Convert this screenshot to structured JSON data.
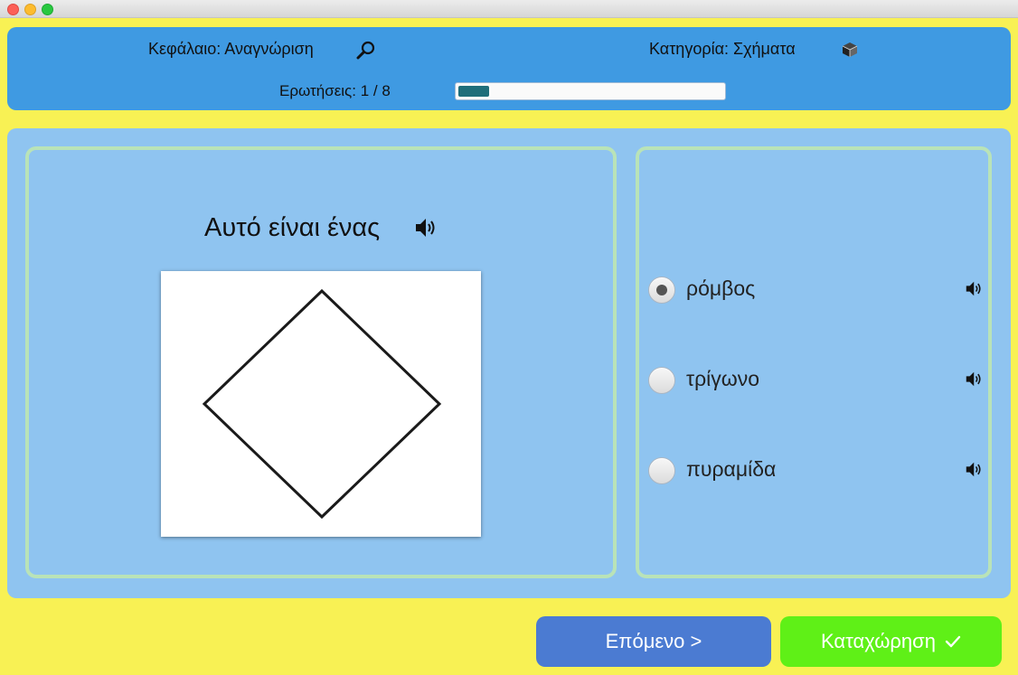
{
  "header": {
    "chapter_label": "Κεφάλαιο: Αναγνώριση",
    "category_label": "Κατηγορία:  Σχήματα",
    "questions_label": "Ερωτήσεις:  1  /  8",
    "progress": {
      "current": 1,
      "total": 8
    }
  },
  "question": {
    "prompt": "Αυτό είναι ένας",
    "shape_icon": "rhombus-outline"
  },
  "answers": [
    {
      "label": "ρόμβος",
      "selected": true
    },
    {
      "label": "τρίγωνο",
      "selected": false
    },
    {
      "label": "πυραμίδα",
      "selected": false
    }
  ],
  "buttons": {
    "next": "Επόμενο >",
    "submit": "Καταχώρηση"
  },
  "colors": {
    "background": "#f8f154",
    "header": "#3f9ae2",
    "panel": "#8fc4f0",
    "card_border": "#b9e3b8",
    "progress_fill": "#1f6e7a",
    "next_button": "#4b7bd2",
    "submit_button": "#5ff017"
  },
  "icons": {
    "chapter": "magnifier-icon",
    "category": "box-icon",
    "audio": "speaker-icon",
    "submit": "check-icon"
  }
}
